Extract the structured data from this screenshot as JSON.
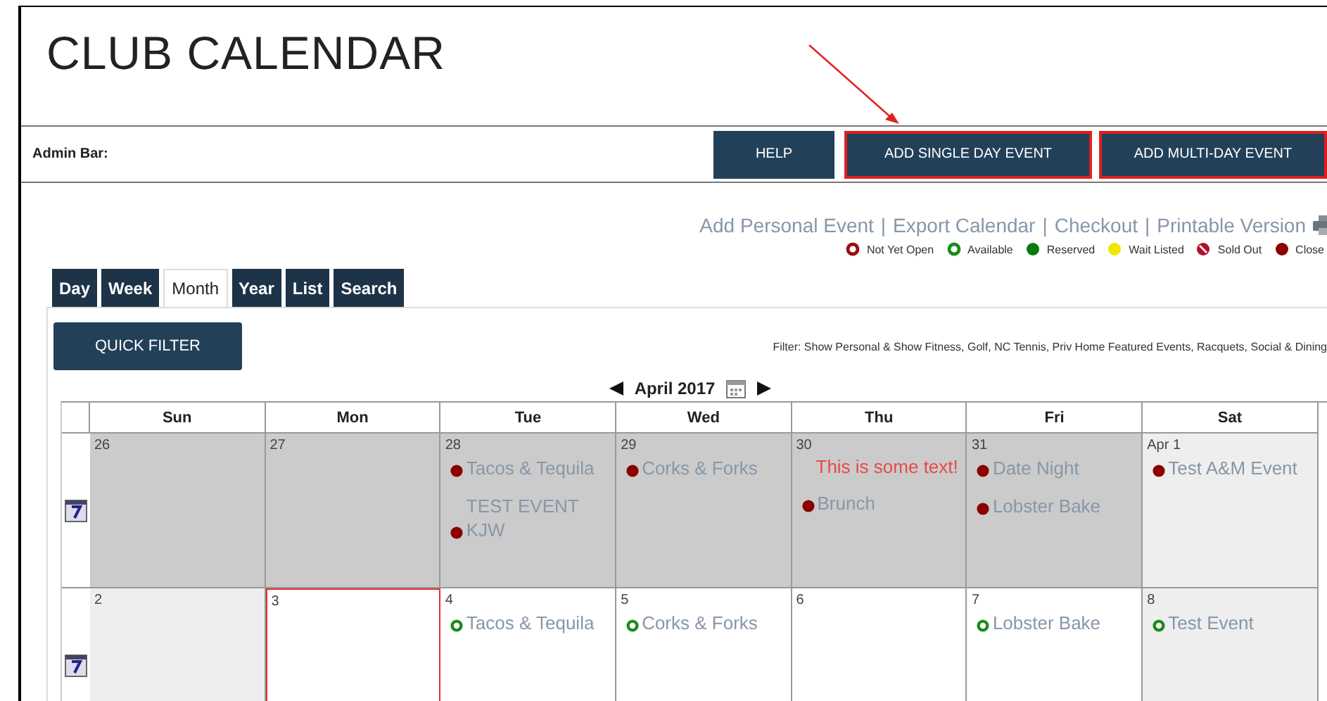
{
  "title": "CLUB CALENDAR",
  "admin_bar": {
    "label": "Admin Bar:",
    "buttons": [
      {
        "label": "HELP",
        "highlighted": false
      },
      {
        "label": "ADD SINGLE DAY EVENT",
        "highlighted": true
      },
      {
        "label": "ADD MULTI-DAY EVENT",
        "highlighted": true
      }
    ]
  },
  "links": [
    {
      "label": "Add Personal Event"
    },
    {
      "separator": "|",
      "label": "Export Calendar"
    },
    {
      "separator": "|",
      "label": "Checkout"
    },
    {
      "separator": "|",
      "label": "Printable Version"
    }
  ],
  "legend": [
    {
      "label": "Not Yet Open",
      "kind": "ring",
      "color": "#9b0d14"
    },
    {
      "label": "Available",
      "kind": "ring",
      "color": "#1d8a1d"
    },
    {
      "label": "Reserved",
      "kind": "filled",
      "color": "#0a7a0a"
    },
    {
      "label": "Wait Listed",
      "kind": "filled",
      "color": "#f2e600"
    },
    {
      "label": "Sold Out",
      "kind": "slashed",
      "color": "#b0102a"
    },
    {
      "label": "Close",
      "kind": "filled",
      "color": "#8b0000"
    }
  ],
  "tabs": [
    {
      "label": "Day",
      "selected": false
    },
    {
      "label": "Week",
      "selected": false
    },
    {
      "label": "Month",
      "selected": true
    },
    {
      "label": "Year",
      "selected": false
    },
    {
      "label": "List",
      "selected": false
    },
    {
      "label": "Search",
      "selected": false
    }
  ],
  "quick_filter": "QUICK FILTER",
  "filter_text": "Filter: Show Personal & Show Fitness, Golf, NC Tennis, Priv Home Featured Events, Racquets, Social & Dining",
  "month": "April 2017",
  "weekdays": [
    "Sun",
    "Mon",
    "Tue",
    "Wed",
    "Thu",
    "Fri",
    "Sat"
  ],
  "weeks": [
    {
      "days": [
        {
          "date": "26",
          "kind": "past"
        },
        {
          "date": "27",
          "kind": "past"
        },
        {
          "date": "28",
          "kind": "past",
          "events": [
            {
              "kind": "event",
              "title": "Tacos & Tequila",
              "color": "#8b0000",
              "hollow": false
            },
            {
              "kind": "event",
              "title": "TEST EVENT KJW",
              "color": "#8b0000",
              "hollow": false
            }
          ]
        },
        {
          "date": "29",
          "kind": "past",
          "events": [
            {
              "kind": "event",
              "title": "Corks & Forks",
              "color": "#8b0000",
              "hollow": false
            }
          ]
        },
        {
          "date": "30",
          "kind": "past",
          "events": [
            {
              "kind": "note",
              "title": "This is some text!"
            },
            {
              "kind": "event",
              "title": "Brunch",
              "color": "#8b0000",
              "hollow": false
            }
          ]
        },
        {
          "date": "31",
          "kind": "past",
          "events": [
            {
              "kind": "event",
              "title": "Date Night",
              "color": "#8b0000",
              "hollow": false
            },
            {
              "kind": "event",
              "title": "Lobster Bake",
              "color": "#8b0000",
              "hollow": false
            }
          ]
        },
        {
          "date": "Apr 1",
          "kind": "weekend",
          "events": [
            {
              "kind": "event",
              "title": "Test A&M Event",
              "color": "#8b0000",
              "hollow": false
            }
          ]
        }
      ]
    },
    {
      "days": [
        {
          "date": "2",
          "kind": "weekend"
        },
        {
          "date": "3",
          "kind": "today"
        },
        {
          "date": "4",
          "kind": "normal",
          "events": [
            {
              "kind": "event",
              "title": "Tacos & Tequila",
              "color": "#1d8a1d",
              "hollow": true
            }
          ]
        },
        {
          "date": "5",
          "kind": "normal",
          "events": [
            {
              "kind": "event",
              "title": "Corks & Forks",
              "color": "#1d8a1d",
              "hollow": true
            }
          ]
        },
        {
          "date": "6",
          "kind": "normal"
        },
        {
          "date": "7",
          "kind": "normal",
          "events": [
            {
              "kind": "event",
              "title": "Lobster Bake",
              "color": "#1d8a1d",
              "hollow": true
            }
          ]
        },
        {
          "date": "8",
          "kind": "weekend",
          "events": [
            {
              "kind": "event",
              "title": "Test Event",
              "color": "#1d8a1d",
              "hollow": true
            }
          ]
        }
      ]
    }
  ]
}
